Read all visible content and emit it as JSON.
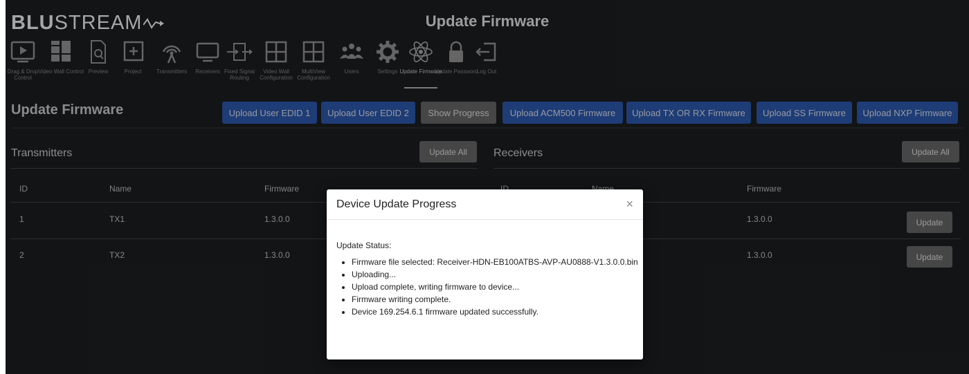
{
  "brand": {
    "logo_text_bold": "BLU",
    "logo_text_light": "STREAM"
  },
  "header": {
    "title": "Update Firmware"
  },
  "nav": [
    {
      "label": "Drag & Drop Control",
      "icon": "play-screen-icon"
    },
    {
      "label": "Video Wall Control",
      "icon": "video-wall-icon"
    },
    {
      "label": "Preview",
      "icon": "preview-document-icon"
    },
    {
      "label": "Project",
      "icon": "plus-box-icon"
    },
    {
      "label": "Transmitters",
      "icon": "broadcast-antenna-icon"
    },
    {
      "label": "Receivers",
      "icon": "monitor-icon"
    },
    {
      "label": "Fixed Signal Routing",
      "icon": "routing-arrows-icon"
    },
    {
      "label": "Video Wall Configuration",
      "icon": "grid-four-icon"
    },
    {
      "label": "MultiView Configuration",
      "icon": "grid-four-icon"
    },
    {
      "label": "Users",
      "icon": "users-group-icon"
    },
    {
      "label": "Settings",
      "icon": "gear-icon"
    },
    {
      "label": "Update Firmware",
      "icon": "atom-icon",
      "active": true
    },
    {
      "label": "Update Password",
      "icon": "padlock-icon"
    },
    {
      "label": "Log Out",
      "icon": "logout-icon"
    }
  ],
  "main": {
    "title": "Update Firmware",
    "buttons": {
      "upload_edid1": "Upload User EDID 1",
      "upload_edid2": "Upload User EDID 2",
      "show_progress": "Show Progress",
      "upload_acm500": "Upload ACM500 Firmware",
      "upload_txrx": "Upload TX OR RX Firmware",
      "upload_ss": "Upload SS Firmware",
      "upload_nxp": "Upload NXP Firmware"
    }
  },
  "transmitters": {
    "title": "Transmitters",
    "update_all": "Update All",
    "columns": [
      "ID",
      "Name",
      "Firmware"
    ],
    "rows": [
      {
        "id": "1",
        "name": "TX1",
        "firmware": "1.3.0.0"
      },
      {
        "id": "2",
        "name": "TX2",
        "firmware": "1.3.0.0"
      }
    ]
  },
  "receivers": {
    "title": "Receivers",
    "update_all": "Update All",
    "columns": [
      "ID",
      "Name",
      "Firmware"
    ],
    "rows": [
      {
        "firmware": "1.3.0.0",
        "button": "Update"
      },
      {
        "firmware": "1.3.0.0",
        "button": "Update"
      }
    ]
  },
  "modal": {
    "title": "Device Update Progress",
    "close": "×",
    "status_label": "Update Status:",
    "messages": [
      "Firmware file selected: Receiver-HDN-EB100ATBS-AVP-AU0888-V1.3.0.0.bin",
      "Uploading...",
      "Upload complete, writing firmware to device...",
      "Firmware writing complete.",
      "Device 169.254.6.1 firmware updated successfully."
    ]
  },
  "colors": {
    "background": "#1e2022",
    "primary_button": "#2f5db6",
    "secondary_button": "#6c6c6c"
  }
}
